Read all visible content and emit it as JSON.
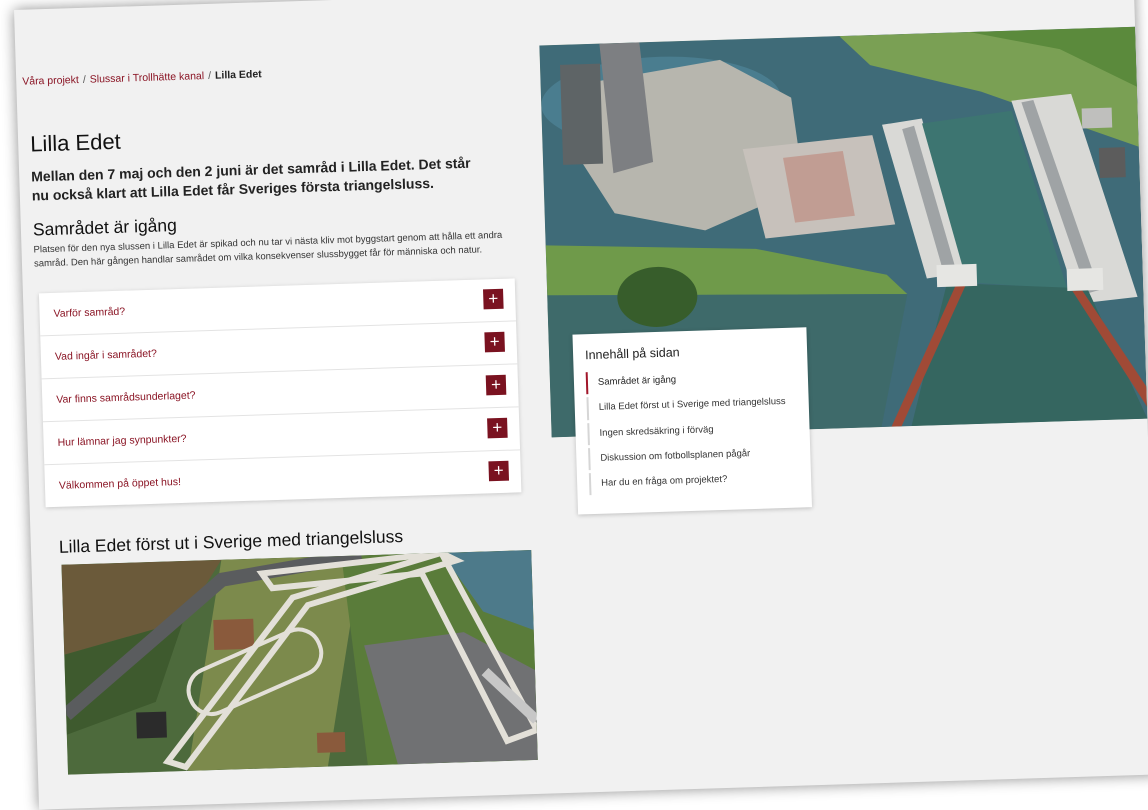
{
  "breadcrumb": {
    "items": [
      "Våra projekt",
      "Slussar i Trollhätte kanal"
    ],
    "current": "Lilla Edet",
    "separator": "/"
  },
  "page": {
    "title": "Lilla Edet",
    "lead": "Mellan den 7 maj och den 2 juni är det samråd i Lilla Edet. Det står nu också klart att Lilla Edet får Sveriges första triangelsluss."
  },
  "section1": {
    "title": "Samrådet är igång",
    "intro": "Platsen för den nya slussen i Lilla Edet är spikad och nu tar vi nästa kliv mot byggstart genom att hålla ett andra samråd. Den här gången handlar samrådet om vilka konsekvenser slussbygget får för människa och natur."
  },
  "accordion": {
    "items": [
      {
        "label": "Varför samråd?"
      },
      {
        "label": "Vad ingår i samrådet?"
      },
      {
        "label": "Var finns samrådsunderlaget?"
      },
      {
        "label": "Hur lämnar jag synpunkter?"
      },
      {
        "label": "Välkommen på öppet hus!"
      }
    ],
    "icon": "plus-icon",
    "icon_glyph": "+"
  },
  "toc": {
    "title": "Innehåll på sidan",
    "items": [
      {
        "label": "Samrådet är igång",
        "active": true
      },
      {
        "label": "Lilla Edet först ut i Sverige med triangelsluss",
        "active": false
      },
      {
        "label": "Ingen skredsäkring i förväg",
        "active": false
      },
      {
        "label": "Diskussion om fotbollsplanen pågår",
        "active": false
      },
      {
        "label": "Har du en fråga om projektet?",
        "active": false
      }
    ]
  },
  "section2": {
    "title": "Lilla Edet först ut i Sverige med triangelsluss"
  },
  "colors": {
    "brand": "#7a1220",
    "link": "#8a1424",
    "background": "#f1f1f1",
    "water": "#3f6b78",
    "grass": "#6f9a4a"
  }
}
